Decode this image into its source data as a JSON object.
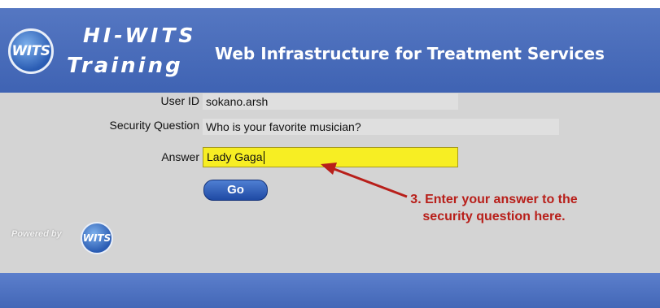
{
  "header": {
    "logo_text": "WITS",
    "brand_line1": "HI-WITS",
    "brand_line2": "Training",
    "subtitle": "Web Infrastructure for Treatment Services"
  },
  "form": {
    "user_id_label": "User ID",
    "user_id_value": "sokano.arsh",
    "security_question_label": "Security Question",
    "security_question_value": "Who is your favorite musician?",
    "answer_label": "Answer",
    "answer_value": "Lady Gaga",
    "go_label": "Go"
  },
  "footer": {
    "powered_by": "Powered by",
    "powered_logo_text": "WITS"
  },
  "annotation": {
    "text": "3. Enter your answer to the security question here."
  },
  "colors": {
    "header_blue": "#4a6dbb",
    "content_gray": "#d4d4d4",
    "answer_highlight": "#f7ee23",
    "annotation_red": "#b81f1a"
  }
}
